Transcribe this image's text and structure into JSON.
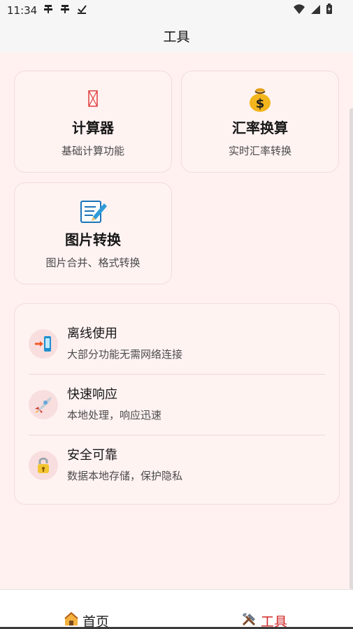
{
  "status_bar": {
    "time": "11:34",
    "left_icons": [
      "notification-icon",
      "notification-icon",
      "download-done-icon"
    ],
    "right_icons": [
      "wifi-icon",
      "signal-icon",
      "battery-icon"
    ]
  },
  "header": {
    "title": "工具"
  },
  "tools": [
    {
      "title": "计算器",
      "description": "基础计算功能",
      "icon": "calculator-icon"
    },
    {
      "title": "汇率换算",
      "description": "实时汇率转换",
      "icon": "money-bag-icon"
    },
    {
      "title": "图片转换",
      "description": "图片合并、格式转换",
      "icon": "memo-pencil-icon"
    }
  ],
  "features": [
    {
      "title": "离线使用",
      "description": "大部分功能无需网络连接",
      "icon": "mobile-arrow-icon"
    },
    {
      "title": "快速响应",
      "description": "本地处理，响应迅速",
      "icon": "rocket-icon"
    },
    {
      "title": "安全可靠",
      "description": "数据本地存储，保护隐私",
      "icon": "lock-icon"
    }
  ],
  "bottom_nav": {
    "home_label": "首页",
    "tools_label": "工具",
    "home_icon": "house-icon",
    "tools_icon": "tools-icon",
    "active_color": "#d12626"
  },
  "colors": {
    "page_background": "#fff1f0",
    "card_background": "#fff3f2",
    "accent_red": "#d12626"
  }
}
